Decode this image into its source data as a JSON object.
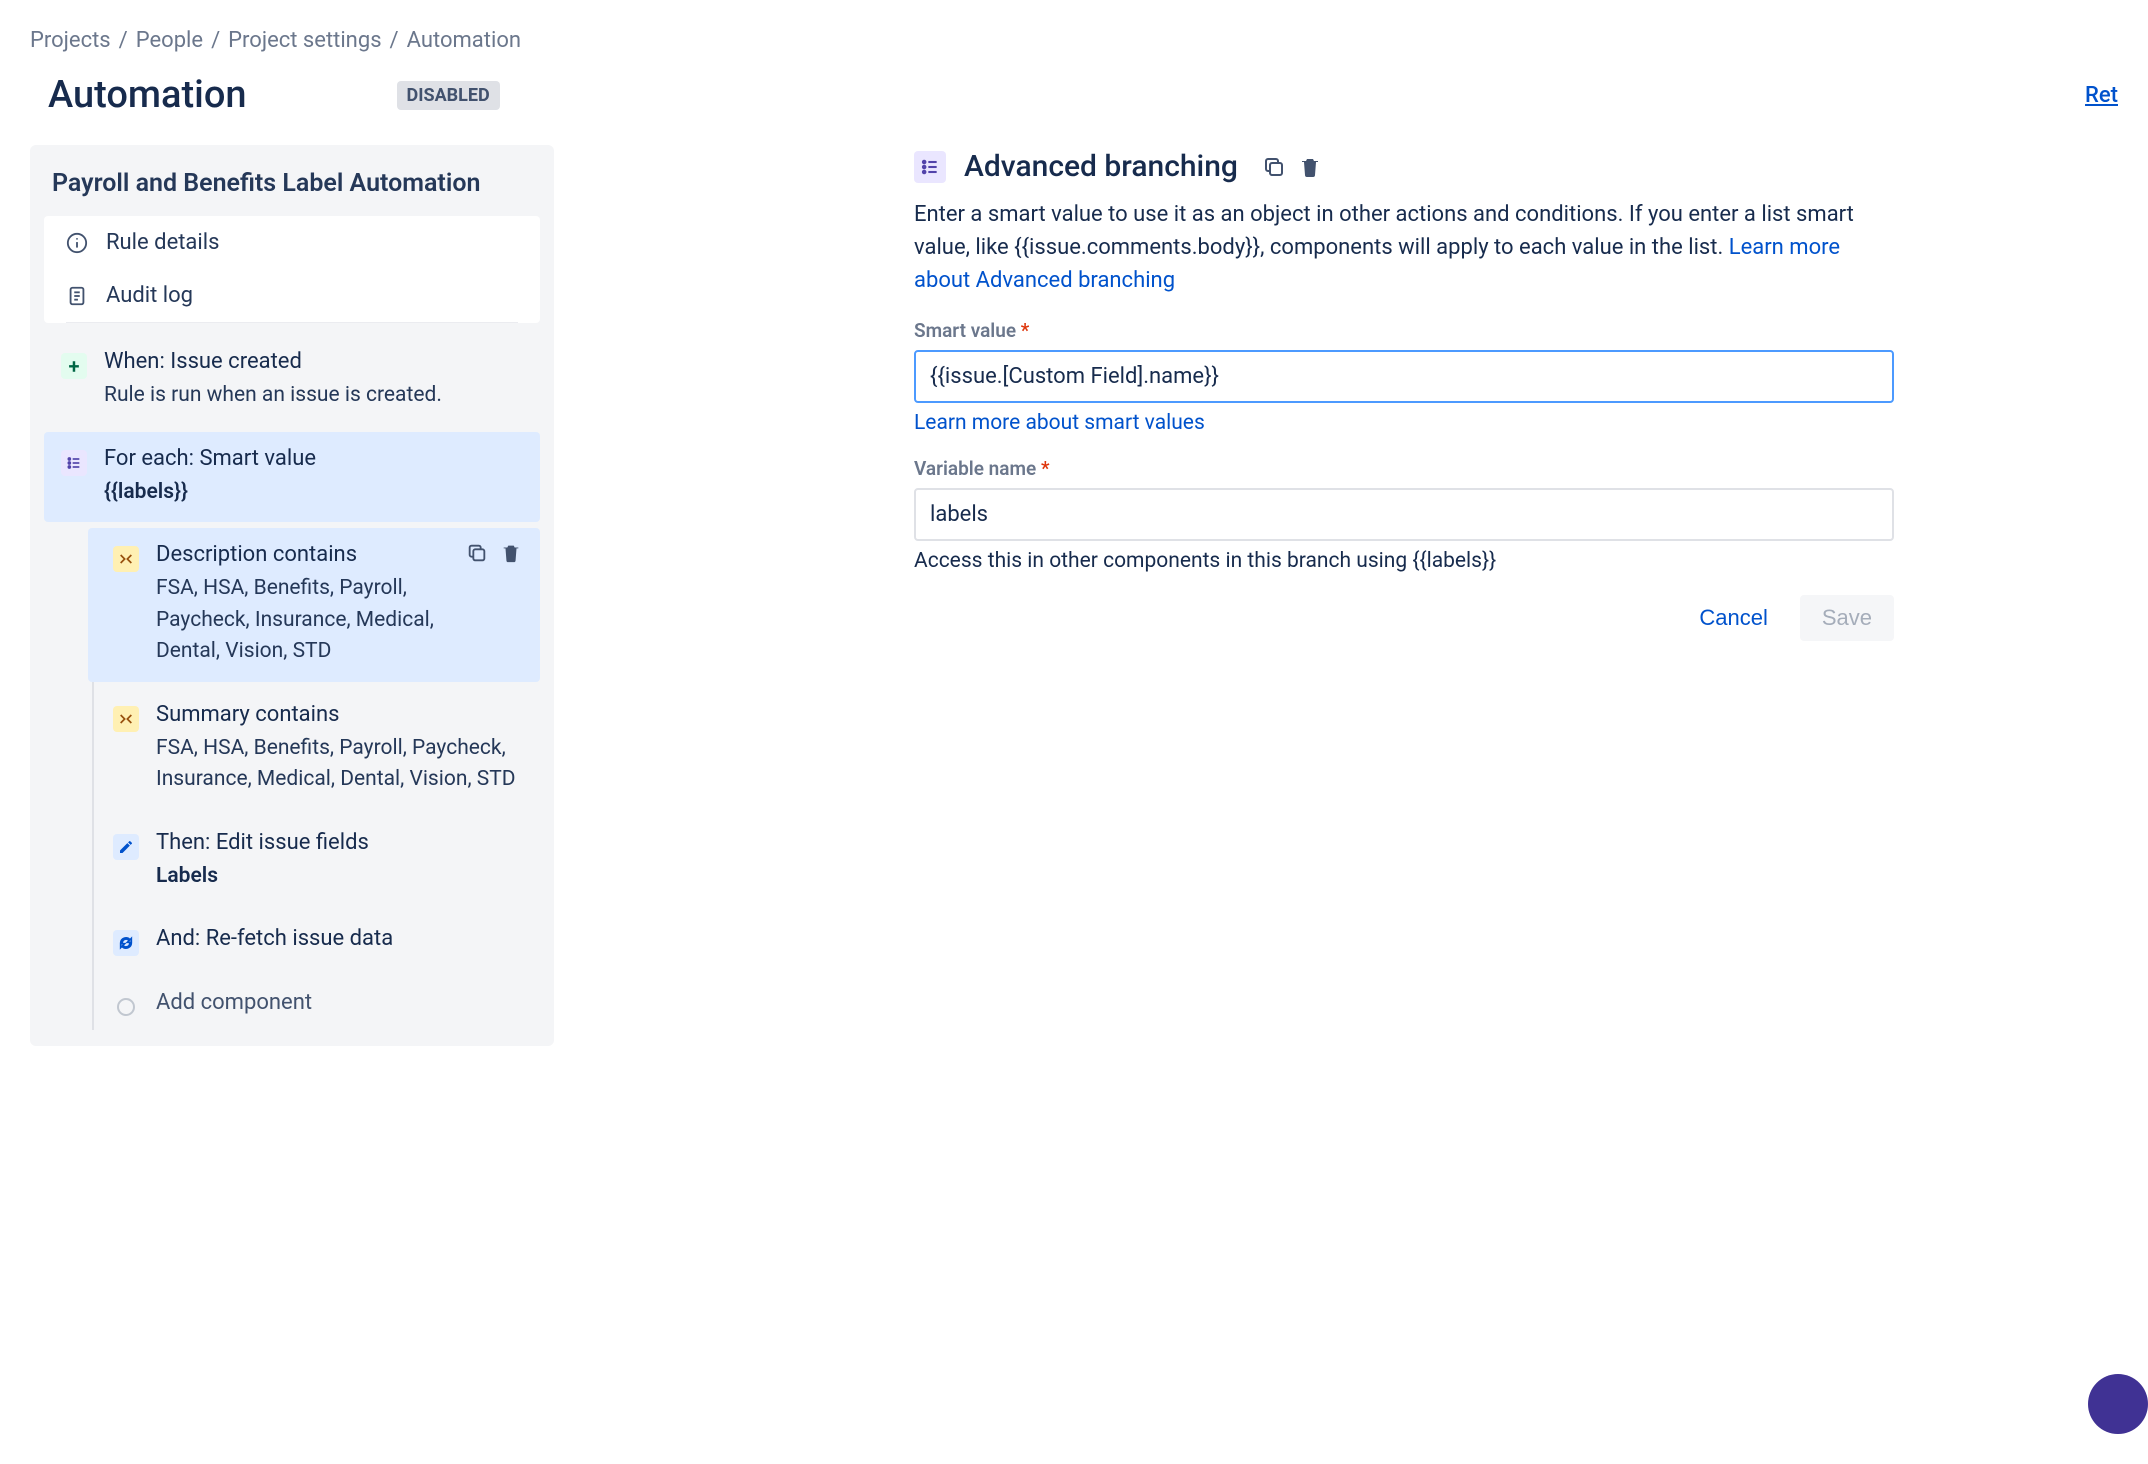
{
  "breadcrumb": [
    "Projects",
    "People",
    "Project settings",
    "Automation"
  ],
  "pageTitle": "Automation",
  "statusBadge": "DISABLED",
  "headerRightLink": "Ret",
  "ruleName": "Payroll and Benefits Label Automation",
  "ruleDetailsLabel": "Rule details",
  "auditLogLabel": "Audit log",
  "trigger": {
    "title": "When: Issue created",
    "subtitle": "Rule is run when an issue is created."
  },
  "branch": {
    "title": "For each: Smart value",
    "value": "{{labels}}"
  },
  "condition1": {
    "title": "Description contains",
    "subtitle": "FSA, HSA, Benefits, Payroll, Paycheck, Insurance, Medical, Dental, Vision, STD"
  },
  "condition2": {
    "title": "Summary contains",
    "subtitle": "FSA, HSA, Benefits, Payroll, Paycheck, Insurance, Medical, Dental, Vision, STD"
  },
  "action1": {
    "title": "Then: Edit issue fields",
    "subtitle": "Labels"
  },
  "action2": {
    "title": "And: Re-fetch issue data"
  },
  "addComponentLabel": "Add component",
  "detail": {
    "title": "Advanced branching",
    "description": "Enter a smart value to use it as an object in other actions and conditions. If you enter a list smart value, like {{issue.comments.body}}, components will apply to each value in the list. ",
    "learnMoreBranching": "Learn more about Advanced branching",
    "smartValueLabel": "Smart value",
    "smartValueInput": "{{issue.[Custom Field].name}}",
    "learnMoreSmart": "Learn more about smart values",
    "variableNameLabel": "Variable name",
    "variableNameInput": "labels",
    "accessHelp": "Access this in other components in this branch using {{labels}}",
    "cancelLabel": "Cancel",
    "saveLabel": "Save"
  }
}
